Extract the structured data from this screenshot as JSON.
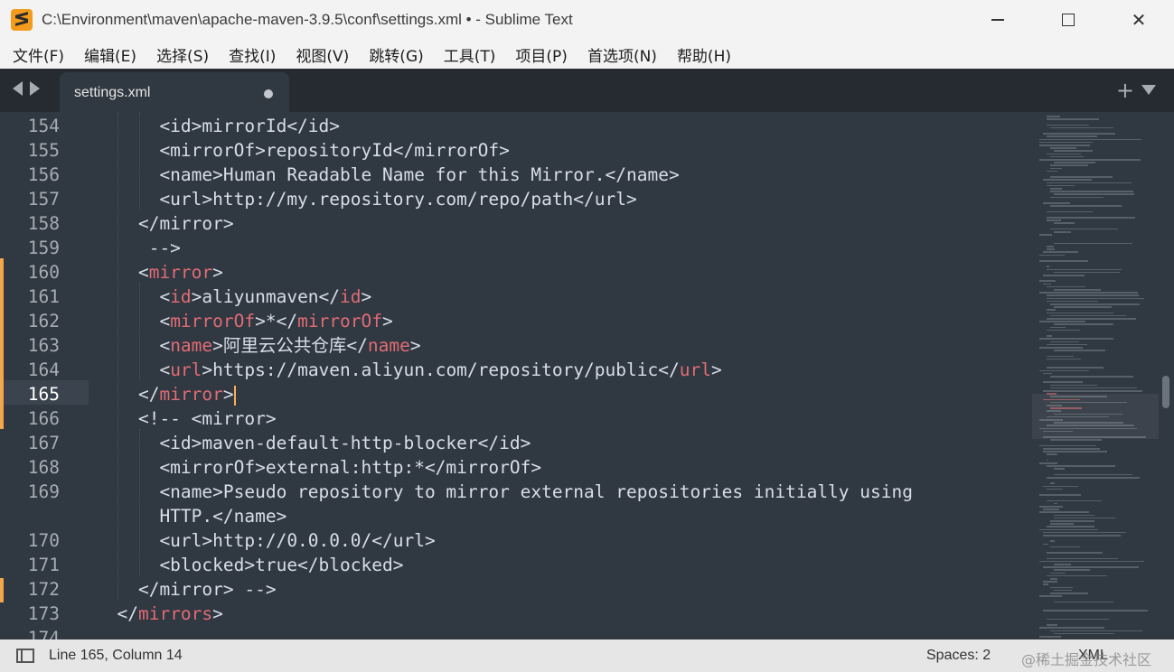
{
  "window": {
    "title": "C:\\Environment\\maven\\apache-maven-3.9.5\\conf\\settings.xml • - Sublime Text",
    "controls": {
      "minimize": "minimize",
      "maximize": "maximize",
      "close": "✕"
    }
  },
  "menu": [
    "文件(F)",
    "编辑(E)",
    "选择(S)",
    "查找(I)",
    "视图(V)",
    "跳转(G)",
    "工具(T)",
    "项目(P)",
    "首选项(N)",
    "帮助(H)"
  ],
  "tab": {
    "label": "settings.xml",
    "modified": true
  },
  "editor": {
    "current_line": "165",
    "lines": [
      {
        "n": "154",
        "segs": [
          {
            "t": "      <id>mirrorId</id>",
            "c": "p"
          }
        ]
      },
      {
        "n": "155",
        "segs": [
          {
            "t": "      <mirrorOf>repositoryId</mirrorOf>",
            "c": "p"
          }
        ]
      },
      {
        "n": "156",
        "segs": [
          {
            "t": "      <name>Human Readable Name for this Mirror.</name>",
            "c": "p"
          }
        ]
      },
      {
        "n": "157",
        "segs": [
          {
            "t": "      <url>http://my.repository.com/repo/path</url>",
            "c": "p"
          }
        ]
      },
      {
        "n": "158",
        "segs": [
          {
            "t": "    </mirror>",
            "c": "p"
          }
        ]
      },
      {
        "n": "159",
        "segs": [
          {
            "t": "     -->",
            "c": "p"
          }
        ]
      },
      {
        "n": "160",
        "segs": [
          {
            "t": "    <",
            "c": "p"
          },
          {
            "t": "mirror",
            "c": "t"
          },
          {
            "t": ">",
            "c": "p"
          }
        ]
      },
      {
        "n": "161",
        "segs": [
          {
            "t": "      <",
            "c": "p"
          },
          {
            "t": "id",
            "c": "t"
          },
          {
            "t": ">aliyunmaven</",
            "c": "p"
          },
          {
            "t": "id",
            "c": "t"
          },
          {
            "t": ">",
            "c": "p"
          }
        ]
      },
      {
        "n": "162",
        "segs": [
          {
            "t": "      <",
            "c": "p"
          },
          {
            "t": "mirrorOf",
            "c": "t"
          },
          {
            "t": ">*</",
            "c": "p"
          },
          {
            "t": "mirrorOf",
            "c": "t"
          },
          {
            "t": ">",
            "c": "p"
          }
        ]
      },
      {
        "n": "163",
        "segs": [
          {
            "t": "      <",
            "c": "p"
          },
          {
            "t": "name",
            "c": "t"
          },
          {
            "t": ">阿里云公共仓库</",
            "c": "p"
          },
          {
            "t": "name",
            "c": "t"
          },
          {
            "t": ">",
            "c": "p"
          }
        ]
      },
      {
        "n": "164",
        "segs": [
          {
            "t": "      <",
            "c": "p"
          },
          {
            "t": "url",
            "c": "t"
          },
          {
            "t": ">https://maven.aliyun.com/repository/public</",
            "c": "p"
          },
          {
            "t": "url",
            "c": "t"
          },
          {
            "t": ">",
            "c": "p"
          }
        ]
      },
      {
        "n": "165",
        "segs": [
          {
            "t": "    </",
            "c": "p"
          },
          {
            "t": "mirror",
            "c": "t"
          },
          {
            "t": ">",
            "c": "p"
          }
        ]
      },
      {
        "n": "166",
        "segs": [
          {
            "t": "    <!-- <mirror>",
            "c": "p"
          }
        ]
      },
      {
        "n": "167",
        "segs": [
          {
            "t": "      <id>maven-default-http-blocker</id>",
            "c": "p"
          }
        ]
      },
      {
        "n": "168",
        "segs": [
          {
            "t": "      <mirrorOf>external:http:*</mirrorOf>",
            "c": "p"
          }
        ]
      },
      {
        "n": "169",
        "segs": [
          {
            "t": "      <name>Pseudo repository to mirror external repositories initially using",
            "c": "p"
          }
        ]
      },
      {
        "n": "",
        "segs": [
          {
            "t": "      HTTP.</name>",
            "c": "p"
          }
        ]
      },
      {
        "n": "170",
        "segs": [
          {
            "t": "      <url>http://0.0.0.0/</url>",
            "c": "p"
          }
        ]
      },
      {
        "n": "171",
        "segs": [
          {
            "t": "      <blocked>true</blocked>",
            "c": "p"
          }
        ]
      },
      {
        "n": "172",
        "segs": [
          {
            "t": "    </mirror> -->",
            "c": "p"
          }
        ]
      },
      {
        "n": "173",
        "segs": [
          {
            "t": "  </",
            "c": "p"
          },
          {
            "t": "mirrors",
            "c": "t"
          },
          {
            "t": ">",
            "c": "p"
          }
        ]
      },
      {
        "n": "174",
        "segs": [
          {
            "t": "",
            "c": "p"
          }
        ]
      }
    ]
  },
  "status": {
    "position": "Line 165, Column 14",
    "spaces": "Spaces: 2",
    "syntax": "XML",
    "watermark": "@稀土掘金技术社区"
  },
  "colors": {
    "tag": "#e06c75",
    "text": "#d8dee9",
    "background": "#303841",
    "modified_bar": "#f5a64a"
  }
}
